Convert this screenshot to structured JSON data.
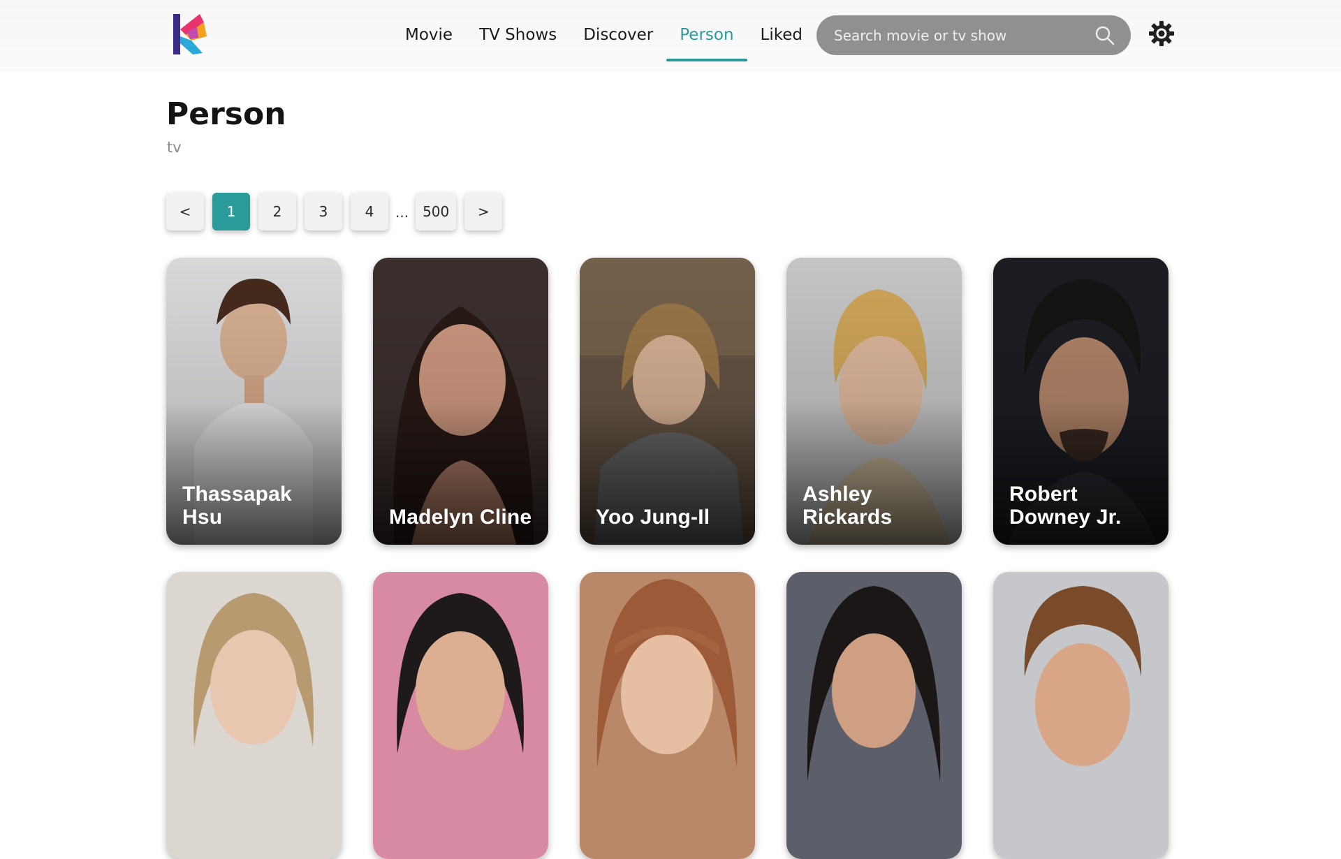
{
  "nav": {
    "items": [
      {
        "label": "Movie"
      },
      {
        "label": "TV Shows"
      },
      {
        "label": "Discover"
      },
      {
        "label": "Person"
      },
      {
        "label": "Liked"
      }
    ],
    "active": "Person"
  },
  "search": {
    "placeholder": "Search movie or tv show",
    "icon": "search-icon"
  },
  "theme_toggle": {
    "icon": "gear-icon"
  },
  "page": {
    "title": "Person",
    "subtitle": "tv"
  },
  "pagination": {
    "prev": "<",
    "pages": [
      "1",
      "2",
      "3",
      "4"
    ],
    "ellipsis": "...",
    "last": "500",
    "next": ">",
    "current": "1"
  },
  "people": [
    {
      "name": "Thassapak Hsu"
    },
    {
      "name": "Madelyn Cline"
    },
    {
      "name": "Yoo Jung-Il"
    },
    {
      "name": "Ashley Rickards"
    },
    {
      "name": "Robert Downey Jr."
    },
    {
      "name": ""
    },
    {
      "name": ""
    },
    {
      "name": ""
    },
    {
      "name": ""
    },
    {
      "name": ""
    }
  ],
  "colors": {
    "accent": "#2a9a9a",
    "search_bg": "#909090"
  }
}
